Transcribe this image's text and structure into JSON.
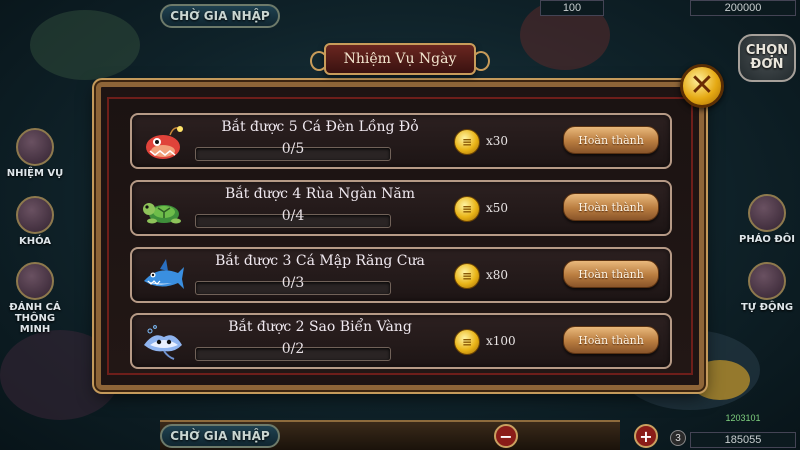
{
  "game": {
    "top_join_label": "CHỜ GIA NHẬP",
    "bottom_join_label": "CHỜ GIA NHẬP",
    "top_score_left": "100",
    "top_score_right": "200000",
    "chon_don_line1": "CHỌN",
    "chon_don_line2": "ĐƠN",
    "left_buttons": [
      "NHIỆM VỤ",
      "KHÓA",
      "ĐÁNH CÁ THÔNG MINH"
    ],
    "right_buttons": [
      "PHÁO ĐÔI",
      "TỰ ĐỘNG"
    ],
    "bottom_cannon_level": "3",
    "bottom_score_top": "1203101",
    "bottom_score": "185055"
  },
  "dialog": {
    "title": "Nhiệm Vụ Ngày",
    "close_symbol": "✕",
    "tasks": [
      {
        "title": "Bắt được 5 Cá Đèn Lồng Đỏ",
        "progress": "0/5",
        "done": 0,
        "goal": 5,
        "reward": "x30",
        "button": "Hoàn thành",
        "icon": "red-lantern-fish-icon"
      },
      {
        "title": "Bắt được 4 Rùa Ngàn Năm",
        "progress": "0/4",
        "done": 0,
        "goal": 4,
        "reward": "x50",
        "button": "Hoàn thành",
        "icon": "turtle-icon"
      },
      {
        "title": "Bắt được 3 Cá Mập Răng Cưa",
        "progress": "0/3",
        "done": 0,
        "goal": 3,
        "reward": "x80",
        "button": "Hoàn thành",
        "icon": "shark-icon"
      },
      {
        "title": "Bắt được 2 Sao Biển Vàng",
        "progress": "0/2",
        "done": 0,
        "goal": 2,
        "reward": "x100",
        "button": "Hoàn thành",
        "icon": "manta-ray-icon"
      }
    ]
  },
  "colors": {
    "frame_gold": "#c49a5b",
    "coin_gold": "#e9b417",
    "button_bronze": "#b97c3f",
    "title_red": "#6a2620"
  }
}
